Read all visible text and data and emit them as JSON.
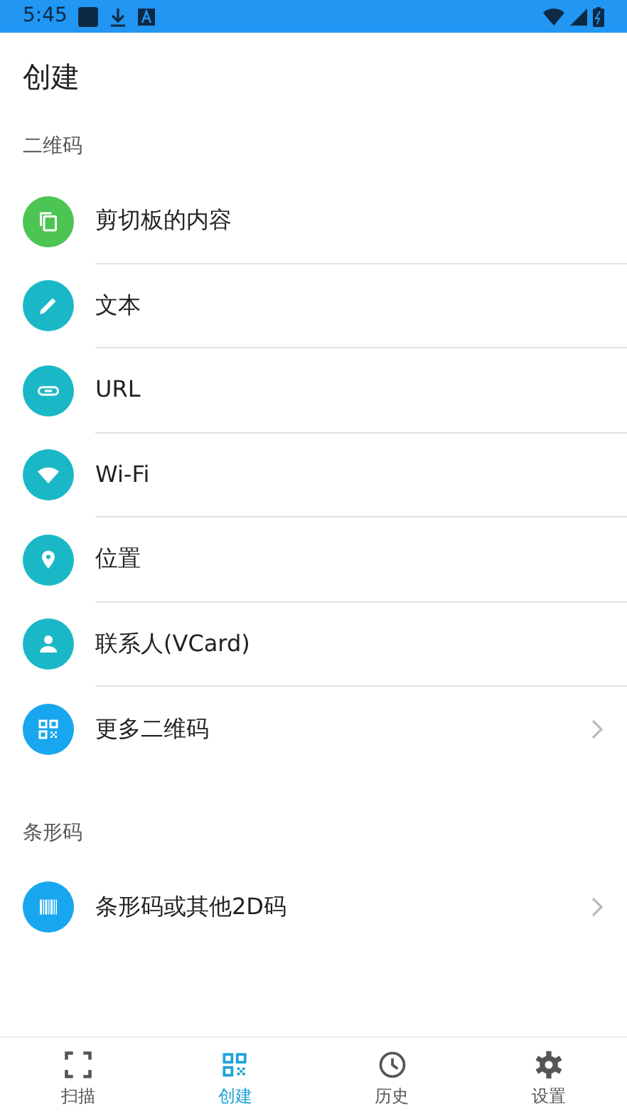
{
  "status_bar": {
    "time": "5:45"
  },
  "title": "创建",
  "sections": [
    {
      "header": "二维码",
      "items": [
        {
          "label": "剪切板的内容",
          "kind": "clipboard",
          "color": "#4cc552",
          "arrow": false
        },
        {
          "label": "文本",
          "kind": "pencil",
          "color": "#1ab8c6",
          "arrow": false
        },
        {
          "label": "URL",
          "kind": "link",
          "color": "#1ab8c6",
          "arrow": false
        },
        {
          "label": "Wi-Fi",
          "kind": "wifi",
          "color": "#1ab8c6",
          "arrow": false
        },
        {
          "label": "位置",
          "kind": "pin",
          "color": "#1ab8c6",
          "arrow": false
        },
        {
          "label": "联系人(VCard)",
          "kind": "person",
          "color": "#1ab8c6",
          "arrow": false
        },
        {
          "label": "更多二维码",
          "kind": "qr",
          "color": "#18a6ee",
          "arrow": true
        }
      ]
    },
    {
      "header": "条形码",
      "items": [
        {
          "label": "条形码或其他2D码",
          "kind": "barcode",
          "color": "#18a6ee",
          "arrow": true
        }
      ]
    }
  ],
  "bottom_nav": [
    {
      "label": "扫描",
      "kind": "scan",
      "selected": false
    },
    {
      "label": "创建",
      "kind": "qr",
      "selected": true
    },
    {
      "label": "历史",
      "kind": "clock",
      "selected": false
    },
    {
      "label": "设置",
      "kind": "gear",
      "selected": false
    }
  ]
}
